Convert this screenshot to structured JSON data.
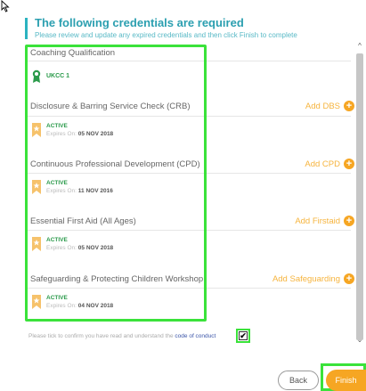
{
  "header": {
    "title": "The following credentials are required",
    "subtitle": "Please review and update any expired credentials and then click Finish to complete"
  },
  "sections": [
    {
      "title": "Coaching Qualification",
      "credential": {
        "name": "UKCC 1"
      }
    },
    {
      "title": "Disclosure & Barring Service Check (CRB)",
      "add_label": "Add DBS",
      "credential": {
        "status": "ACTIVE",
        "expires_label": "Expires On:",
        "expires_value": "05 NOV 2018"
      }
    },
    {
      "title": "Continuous Professional Development (CPD)",
      "add_label": "Add CPD",
      "credential": {
        "status": "ACTIVE",
        "expires_label": "Expires On:",
        "expires_value": "11 NOV 2016"
      }
    },
    {
      "title": "Essential First Aid (All Ages)",
      "add_label": "Add Firstaid",
      "credential": {
        "status": "ACTIVE",
        "expires_label": "Expires On:",
        "expires_value": "05 NOV 2018"
      }
    },
    {
      "title": "Safeguarding & Protecting Children Workshop",
      "add_label": "Add Safeguarding",
      "credential": {
        "status": "ACTIVE",
        "expires_label": "Expires On:",
        "expires_value": "04 NOV 2018"
      }
    }
  ],
  "confirm": {
    "text": "Please tick to confirm you have read and understand the",
    "link": "code of conduct",
    "checked": true,
    "check_mark": "✔"
  },
  "buttons": {
    "back": "Back",
    "finish": "Finish"
  },
  "colors": {
    "accent_teal": "#2b9fb0",
    "add_orange": "#f6a623",
    "active_green": "#2a9a4a",
    "highlight_green": "#3ae23a"
  },
  "icons": {
    "plus": "+",
    "scroll_up": "^",
    "scroll_down": "⌄"
  }
}
